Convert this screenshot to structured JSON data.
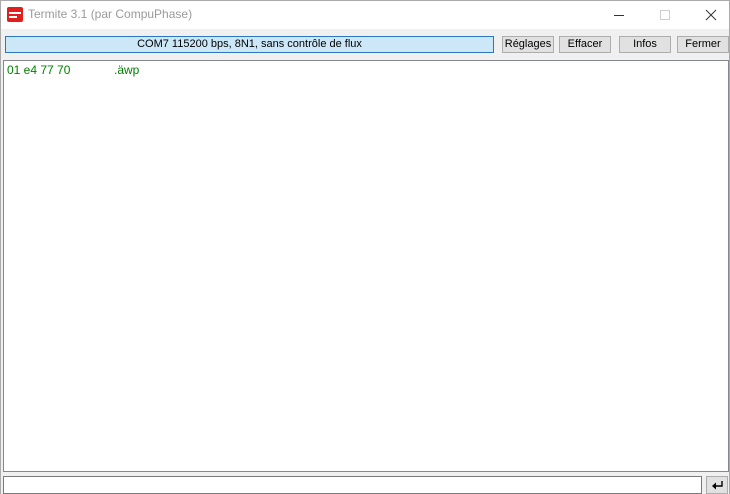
{
  "window": {
    "title": "Termite 3.1 (par CompuPhase)",
    "icon": "termite-app-icon",
    "controls": [
      "minimize-icon",
      "maximize-icon",
      "close-icon"
    ]
  },
  "toolbar": {
    "connection_status": "COM7 115200 bps, 8N1, sans contrôle de flux",
    "settings_label": "Réglages",
    "clear_label": "Effacer",
    "info_label": "Infos",
    "close_label": "Fermer"
  },
  "output": {
    "lines": [
      {
        "hex": "01 e4 77 70",
        "ascii": ".äwp"
      }
    ],
    "text_color": "#008000"
  },
  "input": {
    "value": "",
    "send_icon": "enter-return-icon"
  },
  "colors": {
    "status_background": "#cce8f8",
    "status_border": "#2d78bd",
    "app_icon": "#e0201c"
  }
}
